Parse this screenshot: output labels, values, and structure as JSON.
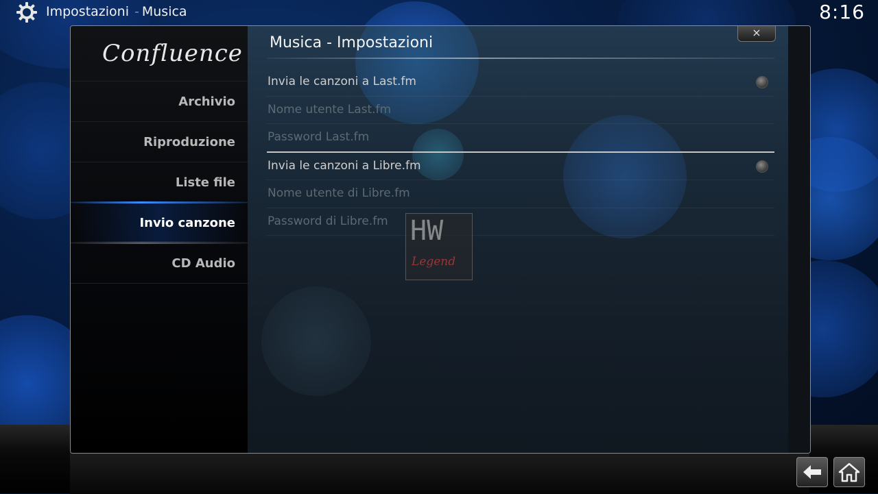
{
  "header": {
    "section": "Impostazioni",
    "separator": "-",
    "subsection": "Musica",
    "clock": "8:16",
    "icon": "gear-icon"
  },
  "sidebar": {
    "logo": "Confluence",
    "items": [
      {
        "label": "Archivio",
        "active": false
      },
      {
        "label": "Riproduzione",
        "active": false
      },
      {
        "label": "Liste file",
        "active": false
      },
      {
        "label": "Invio canzone",
        "active": true
      },
      {
        "label": "CD Audio",
        "active": false
      }
    ]
  },
  "content": {
    "title": "Musica - Impostazioni",
    "close_label": "×",
    "settings": [
      {
        "label": "Invia le canzoni a Last.fm",
        "type": "radio",
        "enabled": true
      },
      {
        "label": "Nome utente Last.fm",
        "type": "text",
        "enabled": false
      },
      {
        "label": "Password Last.fm",
        "type": "text",
        "enabled": false
      },
      {
        "label": "Invia le canzoni a Libre.fm",
        "type": "radio",
        "enabled": true
      },
      {
        "label": "Nome utente di Libre.fm",
        "type": "text",
        "enabled": false
      },
      {
        "label": "Password di Libre.fm",
        "type": "text",
        "enabled": false
      }
    ]
  },
  "watermark": {
    "top": "HW",
    "bottom": "Legend"
  },
  "bottom_buttons": {
    "back_icon": "back-arrow-icon",
    "home_icon": "home-icon"
  },
  "colors": {
    "accent": "#3b8cff",
    "text": "#cfcfcf",
    "disabled_text": "#5d6a73"
  }
}
